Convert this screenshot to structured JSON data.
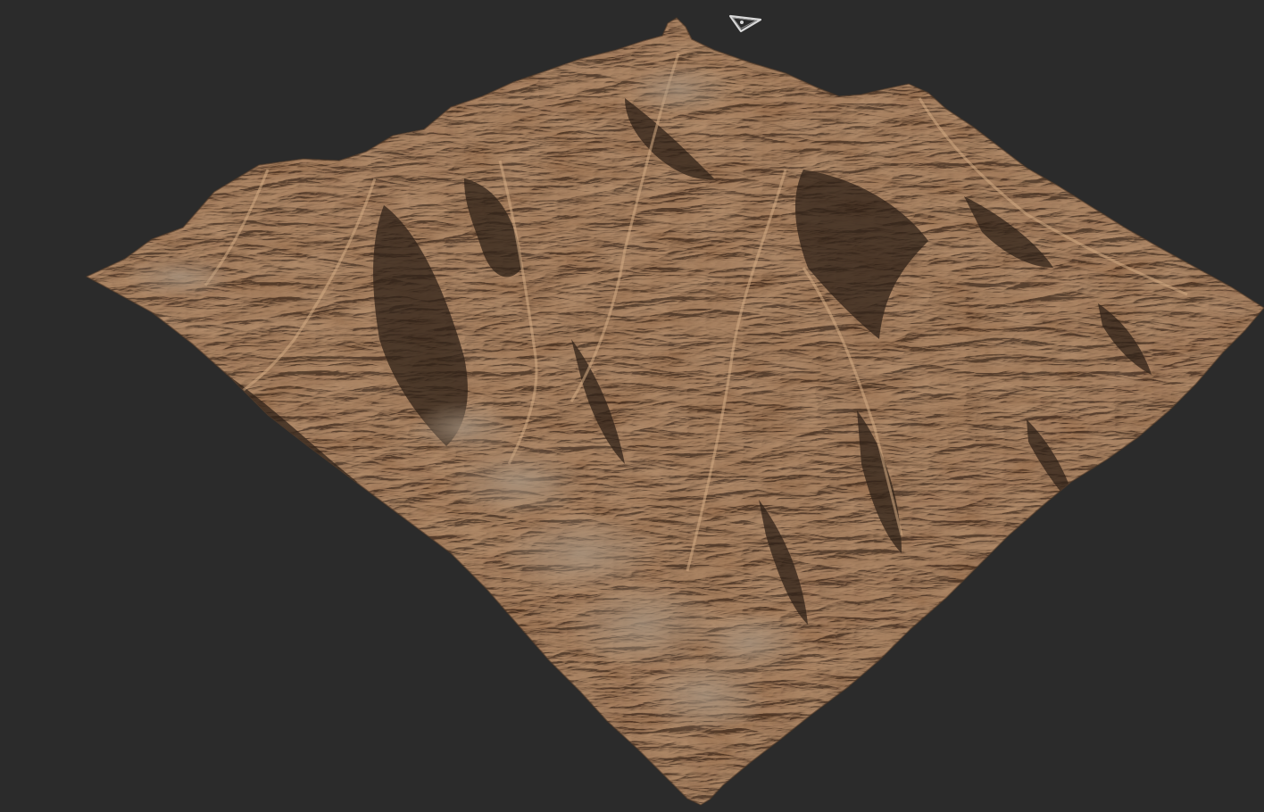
{
  "viewport": {
    "background_color": "#2b2b2b",
    "object": "terrain-mesh"
  },
  "terrain": {
    "base_color": "#9c7659",
    "highlight_color": "#caa27c",
    "shadow_color": "#2f2218",
    "valley_color": "#8f7a66"
  },
  "gizmo": {
    "icon": "camera-icon",
    "stroke_color": "#d8d8d8"
  }
}
